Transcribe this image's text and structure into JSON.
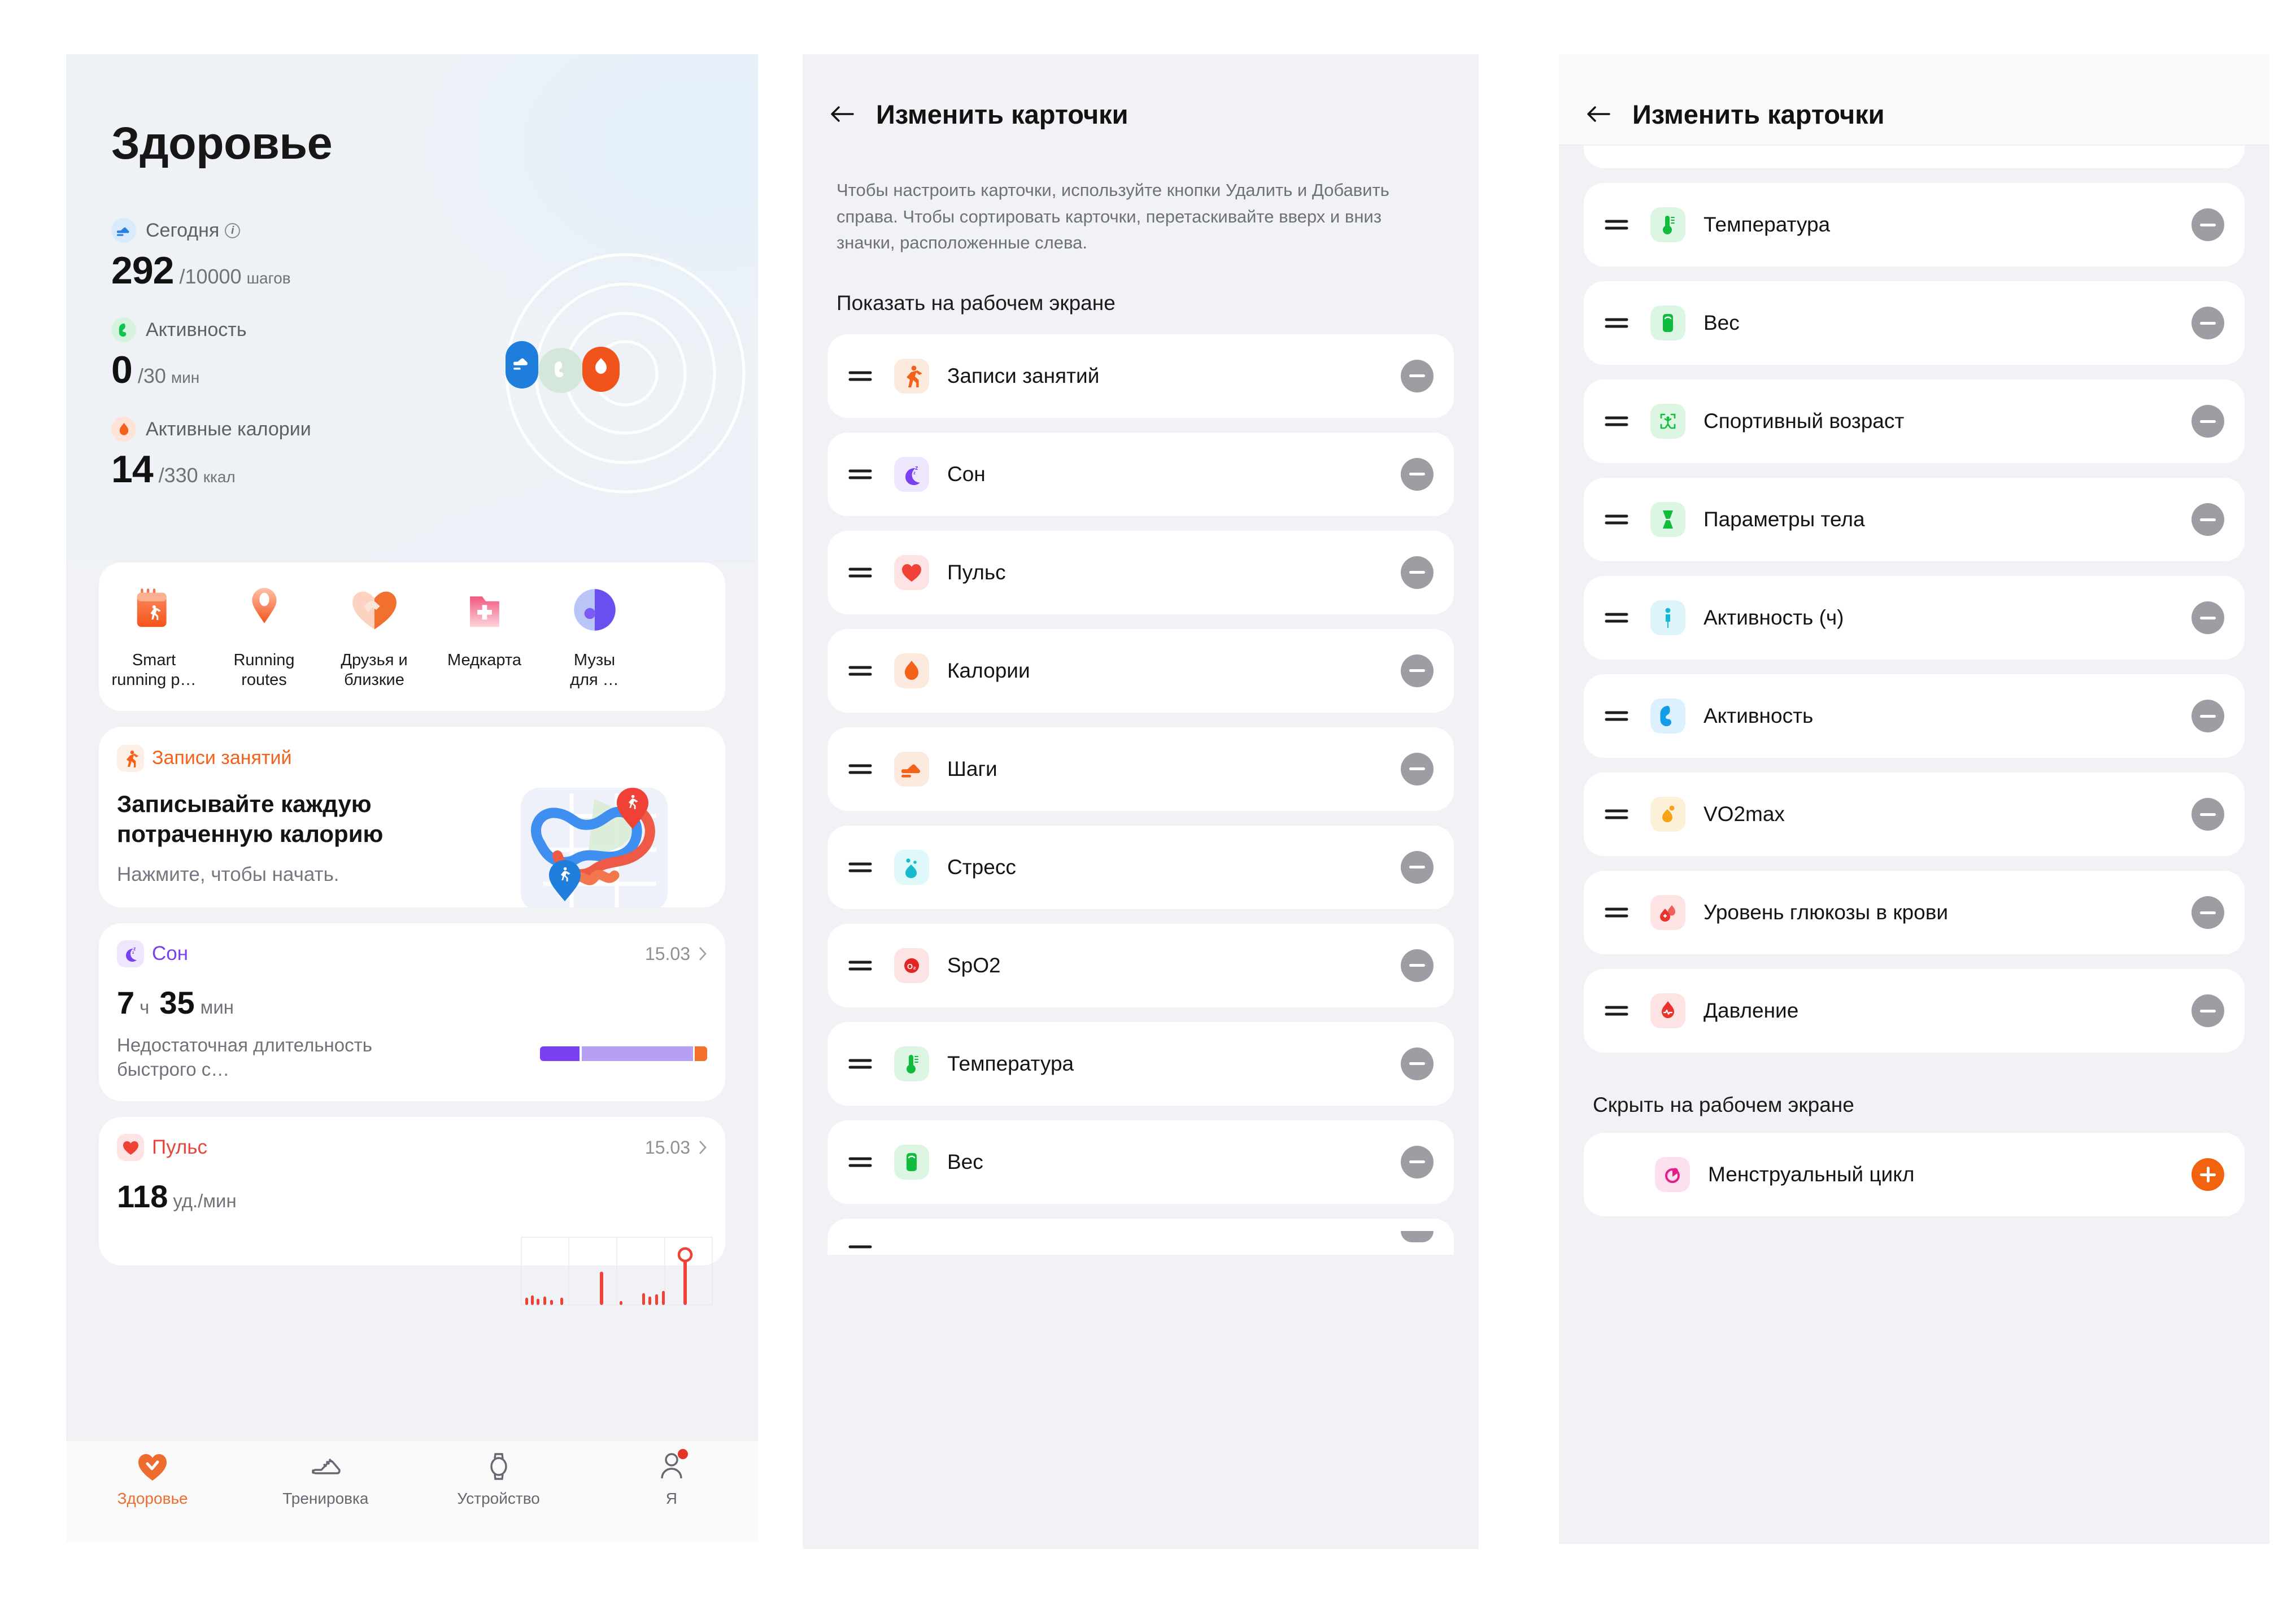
{
  "colors": {
    "accent": "#f2630f",
    "page_bg": "#f1f2f5",
    "card_bg": "#ffffff",
    "minus_pill": "#9c9ea3",
    "plus_pill": "#f2630f",
    "nav_active": "#ef6c2f"
  },
  "home": {
    "title": "Здоровье",
    "metrics": [
      {
        "icon": "shoe-icon",
        "label": "Сегодня",
        "has_info": true,
        "value": "292",
        "goal": "/10000",
        "unit": "шагов",
        "dot_bg": "#d8eafc",
        "icon_color": "#2b7fe0"
      },
      {
        "icon": "muscle-icon",
        "label": "Активность",
        "has_info": false,
        "value": "0",
        "goal": "/30",
        "unit": "мин",
        "dot_bg": "#d6f3e0",
        "icon_color": "#12c24f"
      },
      {
        "icon": "flame-icon",
        "label": "Активные калории",
        "has_info": false,
        "value": "14",
        "goal": "/330",
        "unit": "ккал",
        "dot_bg": "#fde4d7",
        "icon_color": "#f4611a"
      }
    ],
    "shortcuts": [
      {
        "icon": "running-plan-icon",
        "label": "Smart\nrunning p…"
      },
      {
        "icon": "route-pin-icon",
        "label": "Running\nroutes"
      },
      {
        "icon": "handshake-heart-icon",
        "label": "Друзья и\nблизкие"
      },
      {
        "icon": "medical-record-icon",
        "label": "Медкарта"
      },
      {
        "icon": "music-icon",
        "label": "Музы\nдля …"
      }
    ],
    "promo": {
      "tag": "Записи занятий",
      "tag_icon": "runner-icon",
      "heading": "Записывайте каждую потраченную калорию",
      "subtitle": "Нажмите, чтобы начать.",
      "art": "running-route-map"
    },
    "sleep_card": {
      "icon": "moon-sleep-icon",
      "title": "Сон",
      "title_color": "#7b3ff2",
      "date": "15.03",
      "hours": "7",
      "hours_unit": "ч",
      "minutes": "35",
      "minutes_unit": "мин",
      "description": "Недостаточная длительность быстрого с…",
      "bar_segments": [
        "#7b3ff2",
        "#b5a0f5",
        "#f2722c"
      ]
    },
    "pulse_card": {
      "icon": "heart-icon",
      "title": "Пульс",
      "title_color": "#e8453c",
      "date": "15.03",
      "value": "118",
      "unit": "уд./мин",
      "chart_color": "#ef4136"
    },
    "nav": [
      {
        "icon": "heart-check-icon",
        "label": "Здоровье",
        "active": true,
        "badge": false
      },
      {
        "icon": "shoe-outline-icon",
        "label": "Тренировка",
        "active": false,
        "badge": false
      },
      {
        "icon": "watch-icon",
        "label": "Устройство",
        "active": false,
        "badge": false
      },
      {
        "icon": "person-icon",
        "label": "Я",
        "active": false,
        "badge": true
      }
    ]
  },
  "cards_screen_1": {
    "title": "Изменить карточки",
    "back_icon": "back-arrow-icon",
    "description": "Чтобы настроить карточки, используйте кнопки Удалить и Добавить справа. Чтобы сортировать карточки, перетаскивайте вверх и вниз значки, расположенные слева.",
    "section_title": "Показать на рабочем экране",
    "items": [
      {
        "label": "Записи занятий",
        "icon": "runner-icon",
        "icon_bg": "#fdeadf",
        "icon_color": "#f4611a",
        "action": "minus"
      },
      {
        "label": "Сон",
        "icon": "moon-sleep-icon",
        "icon_bg": "#eee6fd",
        "icon_color": "#7b3ff2",
        "action": "minus"
      },
      {
        "label": "Пульс",
        "icon": "heart-icon",
        "icon_bg": "#fde3e3",
        "icon_color": "#e8453c",
        "action": "minus"
      },
      {
        "label": "Калории",
        "icon": "flame-icon",
        "icon_bg": "#fdeadf",
        "icon_color": "#f4611a",
        "action": "minus"
      },
      {
        "label": "Шаги",
        "icon": "shoe-icon",
        "icon_bg": "#fdeadf",
        "icon_color": "#f4611a",
        "action": "minus"
      },
      {
        "label": "Стресс",
        "icon": "stress-icon",
        "icon_bg": "#dff8f9",
        "icon_color": "#16bccd",
        "action": "minus"
      },
      {
        "label": "SpO2",
        "icon": "spo2-icon",
        "icon_bg": "#fde3e3",
        "icon_color": "#e32424",
        "action": "minus"
      },
      {
        "label": "Температура",
        "icon": "thermometer-icon",
        "icon_bg": "#ddf6e3",
        "icon_color": "#10bc3e",
        "action": "minus"
      },
      {
        "label": "Вес",
        "icon": "scale-icon",
        "icon_bg": "#ddf6e3",
        "icon_color": "#10bc3e",
        "action": "minus"
      }
    ]
  },
  "cards_screen_2": {
    "title": "Изменить карточки",
    "back_icon": "back-arrow-icon",
    "items": [
      {
        "label": "Температура",
        "icon": "thermometer-icon",
        "icon_bg": "#ddf6e3",
        "icon_color": "#10bc3e",
        "action": "minus"
      },
      {
        "label": "Вес",
        "icon": "scale-icon",
        "icon_bg": "#ddf6e3",
        "icon_color": "#10bc3e",
        "action": "minus"
      },
      {
        "label": "Спортивный возраст",
        "icon": "body-scan-icon",
        "icon_bg": "#ddf6e3",
        "icon_color": "#10bc3e",
        "action": "minus"
      },
      {
        "label": "Параметры тела",
        "icon": "body-shape-icon",
        "icon_bg": "#ddf6e3",
        "icon_color": "#10bc3e",
        "action": "minus"
      },
      {
        "label": "Активность (ч)",
        "icon": "standing-icon",
        "icon_bg": "#ddf4fb",
        "icon_color": "#14b9d8",
        "action": "minus"
      },
      {
        "label": "Активность",
        "icon": "muscle-icon",
        "icon_bg": "#ddf0fd",
        "icon_color": "#149ce6",
        "action": "minus"
      },
      {
        "label": "VO2max",
        "icon": "vo2max-icon",
        "icon_bg": "#fdf0d9",
        "icon_color": "#f7a313",
        "action": "minus"
      },
      {
        "label": "Уровень глюкозы в крови",
        "icon": "glucose-icon",
        "icon_bg": "#fde3e3",
        "icon_color": "#e8342c",
        "action": "minus"
      },
      {
        "label": "Давление",
        "icon": "pressure-icon",
        "icon_bg": "#fde3e3",
        "icon_color": "#e8342c",
        "action": "minus"
      }
    ],
    "hidden_section_title": "Скрыть на рабочем экране",
    "hidden_items": [
      {
        "label": "Менструальный цикл",
        "icon": "cycle-icon",
        "icon_bg": "#fde0ef",
        "icon_color": "#e51f86",
        "action": "plus"
      }
    ]
  }
}
